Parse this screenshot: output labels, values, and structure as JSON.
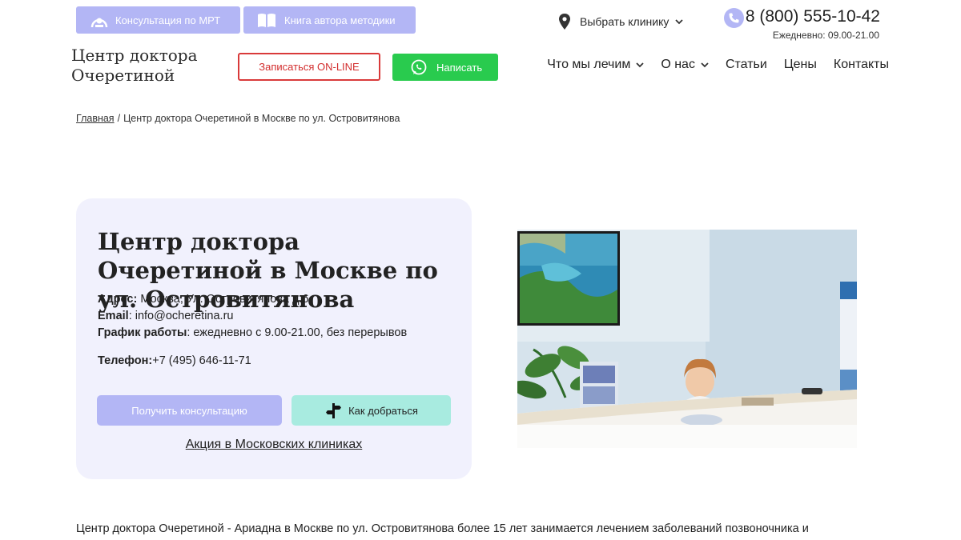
{
  "header": {
    "promo_mri": "Консультация по МРТ",
    "promo_book": "Книга автора методики",
    "logo_line1": "Центр доктора",
    "logo_line2": "Очеретиной",
    "cta_online": "Записаться ON-LINE",
    "cta_write": "Написать",
    "clinic_select": "Выбрать клинику",
    "phone": "8 (800) 555-10-42",
    "hours": "Ежедневно: 09.00-21.00"
  },
  "nav": {
    "items": [
      {
        "label": "Что мы лечим",
        "dropdown": true
      },
      {
        "label": "О нас",
        "dropdown": true
      },
      {
        "label": "Статьи",
        "dropdown": false
      },
      {
        "label": "Цены",
        "dropdown": false
      },
      {
        "label": "Контакты",
        "dropdown": false
      }
    ]
  },
  "breadcrumb": {
    "home": "Главная",
    "separator": "/",
    "current": "Центр доктора Очеретиной в Москве по ул. Островитянова"
  },
  "card": {
    "title": "Центр доктора Очеретиной в Москве по ул. Островитянова",
    "address_label": "Адрес:",
    "address_value": " Москва, Ул. Островитянова д.6",
    "email_label": "Email",
    "email_value": ": info@ocheretina.ru",
    "hours_label": "График работы",
    "hours_value": ": ежедневно с 9.00-21.00, без перерывов",
    "phone_label": "Телефон:",
    "phone_value": "+7 (495) 646-11-71",
    "btn_consult": "Получить консультацию",
    "btn_route": "Как добраться",
    "promo_link": "Акция в Московских клиниках"
  },
  "description": "Центр доктора Очеретиной - Ариадна в Москве по ул. Островитянова более 15 лет занимается лечением заболеваний позвоночника и",
  "colors": {
    "accent_lavender": "#b3b6f5",
    "cta_red": "#d93a3a",
    "whatsapp_green": "#29cb4e",
    "route_mint": "#a8ebe0",
    "card_bg": "#f1f1fd"
  },
  "icons": [
    "mri-scanner-icon",
    "book-icon",
    "whatsapp-icon",
    "location-pin-icon",
    "chevron-down-icon",
    "phone-icon",
    "signpost-icon"
  ]
}
